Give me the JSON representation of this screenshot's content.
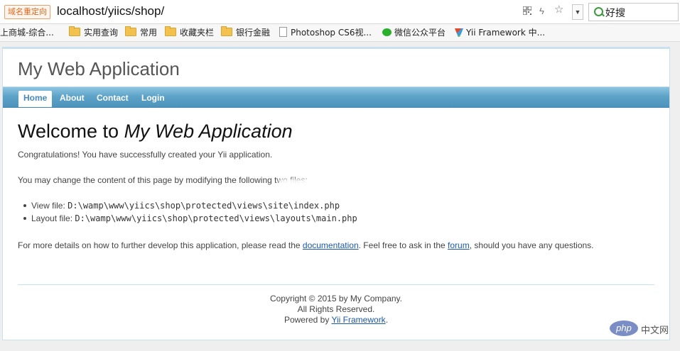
{
  "browser": {
    "redirect_badge": "域名重定向",
    "url": "localhost/yiics/shop/",
    "search_text": "好搜"
  },
  "bookmarks": [
    {
      "label": "上商城-综合...",
      "icon": "none"
    },
    {
      "label": "实用查询",
      "icon": "folder-icon"
    },
    {
      "label": "常用",
      "icon": "folder-icon"
    },
    {
      "label": "收藏夹栏",
      "icon": "folder-icon"
    },
    {
      "label": "银行金融",
      "icon": "folder-icon"
    },
    {
      "label": "Photoshop CS6视...",
      "icon": "page-icon"
    },
    {
      "label": "微信公众平台",
      "icon": "wechat-icon"
    },
    {
      "label": "Yii Framework 中...",
      "icon": "yii-icon"
    }
  ],
  "app": {
    "title": "My Web Application",
    "menu": [
      "Home",
      "About",
      "Contact",
      "Login"
    ],
    "active_menu": "Home"
  },
  "content": {
    "welcome_prefix": "Welcome to ",
    "welcome_app": "My Web Application",
    "congrats": "Congratulations! You have successfully created your Yii application.",
    "change_text": "You may change the content of this page by modifying the following two files:",
    "view_label": "View file: ",
    "view_path": "D:\\wamp\\www\\yiics\\shop\\protected\\views\\site\\index.php",
    "layout_label": "Layout file: ",
    "layout_path": "D:\\wamp\\www\\yiics\\shop\\protected\\views\\layouts\\main.php",
    "details_before": "For more details on how to further develop this application, please read the ",
    "documentation_link": "documentation",
    "details_middle": ". Feel free to ask in the ",
    "forum_link": "forum",
    "details_after": ", should you have any questions."
  },
  "footer": {
    "copyright": "Copyright © 2015 by My Company.",
    "rights": "All Rights Reserved.",
    "powered_prefix": "Powered by ",
    "powered_link": "Yii Framework",
    "powered_suffix": "."
  },
  "watermark": {
    "logo": "php",
    "text": "中文网"
  },
  "colors": {
    "menu_blue": "#5da3c8",
    "link": "#1b59a8",
    "page_border": "#c9e0ed"
  }
}
